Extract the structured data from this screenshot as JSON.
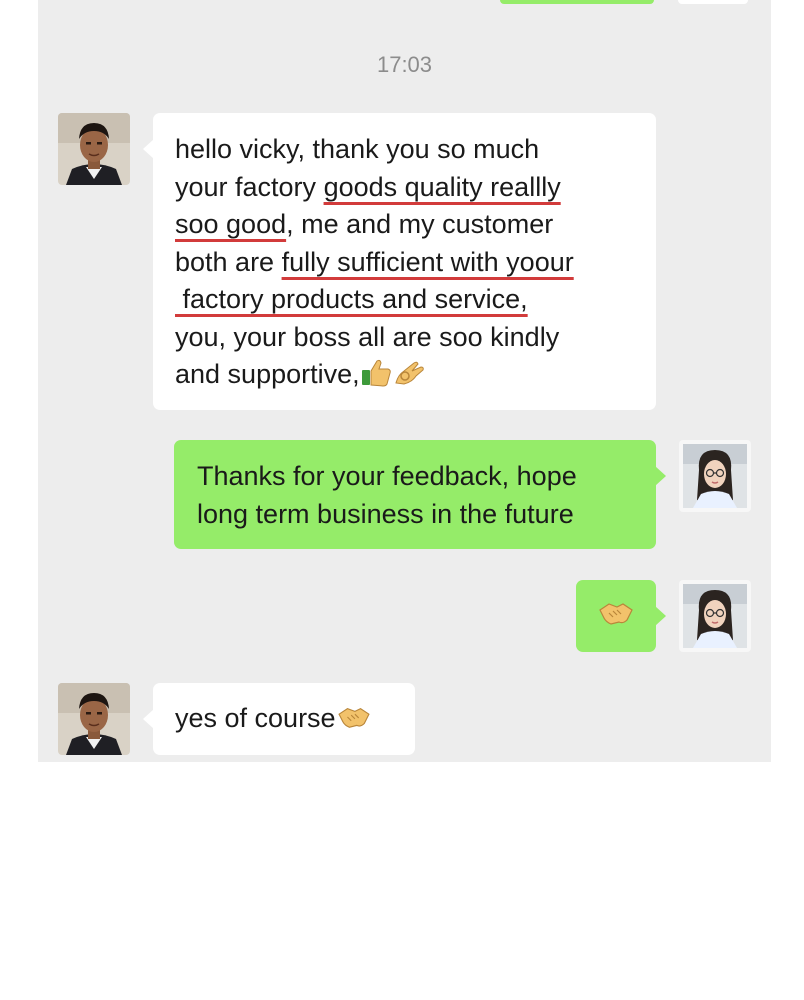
{
  "chat": {
    "timestamp": "17:03",
    "messages": [
      {
        "sender": "contact",
        "lines": [
          {
            "segments": [
              {
                "text": "hello vicky, thank you so much",
                "underline": false
              }
            ]
          },
          {
            "segments": [
              {
                "text": "your factory ",
                "underline": false
              },
              {
                "text": "goods quality reallly",
                "underline": true
              }
            ]
          },
          {
            "segments": [
              {
                "text": "soo good",
                "underline": true
              },
              {
                "text": ", me and my customer",
                "underline": false
              }
            ]
          },
          {
            "segments": [
              {
                "text": "both are ",
                "underline": false
              },
              {
                "text": "fully sufficient with yoour",
                "underline": true
              }
            ]
          },
          {
            "segments": [
              {
                "text": " factory products and service,",
                "underline": true
              }
            ]
          },
          {
            "segments": [
              {
                "text": "you, your boss all are soo kindly",
                "underline": false
              }
            ]
          },
          {
            "segments": [
              {
                "text": "and supportive,",
                "underline": false
              }
            ]
          }
        ],
        "emojis": [
          "thumbs-up-icon",
          "ok-hand-icon"
        ]
      },
      {
        "sender": "me",
        "lines": [
          {
            "text": "Thanks for your feedback, hope"
          },
          {
            "text": "long term business in the future"
          }
        ]
      },
      {
        "sender": "me",
        "emojis": [
          "handshake-icon"
        ]
      },
      {
        "sender": "contact",
        "text": "yes of course",
        "emojis": [
          "handshake-icon"
        ]
      }
    ]
  },
  "colors": {
    "chat_background": "#ededed",
    "incoming_bubble": "#ffffff",
    "outgoing_bubble": "#95ec69",
    "underline": "#d23b3b",
    "timestamp_text": "#8c8c8c"
  }
}
